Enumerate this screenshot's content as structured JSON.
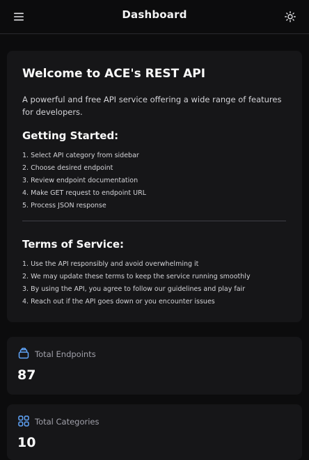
{
  "header": {
    "title": "Dashboard",
    "menu_icon": "hamburger-menu-icon",
    "theme_icon": "sun-icon"
  },
  "welcome": {
    "title": "Welcome to ACE's REST API",
    "description": "A powerful and free API service offering a wide range of features for developers.",
    "getting_started": {
      "title": "Getting Started:",
      "steps": [
        "1. Select API category from sidebar",
        "2. Choose desired endpoint",
        "3. Review endpoint documentation",
        "4. Make GET request to endpoint URL",
        "5. Process JSON response"
      ]
    },
    "terms": {
      "title": "Terms of Service:",
      "items": [
        "1. Use the API responsibly and avoid overwhelming it",
        "2. We may update these terms to keep the service running smoothly",
        "3. By using the API, you agree to follow our guidelines and play fair",
        "4. Reach out if the API goes down or you encounter issues"
      ]
    }
  },
  "stats": [
    {
      "label": "Total Endpoints",
      "value": "87",
      "icon": "layers-icon"
    },
    {
      "label": "Total Categories",
      "value": "10",
      "icon": "grid-icon"
    }
  ],
  "colors": {
    "background": "#0c0c0d",
    "card": "#161618",
    "accent_icon": "#60a5fa",
    "text": "#fafafa",
    "muted": "#a1a1aa"
  }
}
